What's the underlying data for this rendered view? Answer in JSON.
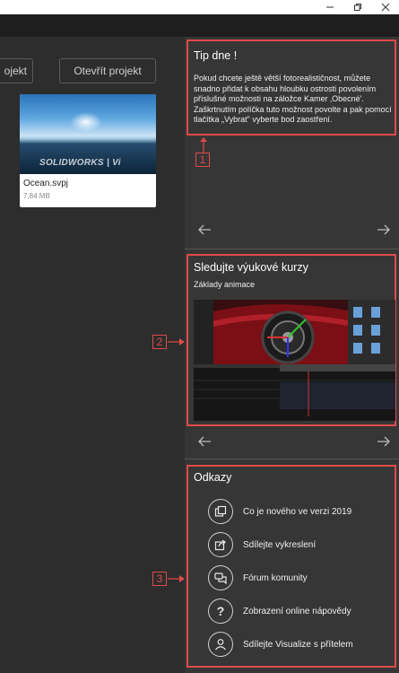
{
  "window": {
    "minimize_icon": "minimize-icon",
    "restore_icon": "restore-icon",
    "close_icon": "close-icon"
  },
  "left": {
    "new_project_button_partial": "ojekt",
    "open_project_button": "Otevřít projekt",
    "recent_file": {
      "name": "Ocean.svpj",
      "size": "7,84 MB",
      "thumbnail_watermark": "SOLIDWORKS | Vi"
    }
  },
  "tip": {
    "title": "Tip dne !",
    "text": "Pokud chcete ještě větší fotorealističnost, můžete snadno přidat k obsahu hloubku ostrosti povolením příslušné možnosti na záložce Kamer ‚Obecné'. Zaškrtnutím políčka tuto možnost povolte a pak pomocí tlačítka „Vybrat\" vyberte bod zaostření.",
    "callout": "1"
  },
  "tutorials": {
    "title": "Sledujte výukové kurzy",
    "subtitle": "Základy animace",
    "callout": "2"
  },
  "links": {
    "title": "Odkazy",
    "callout": "3",
    "items": [
      {
        "label": "Co je nového ve verzi 2019",
        "icon": "copy-icon"
      },
      {
        "label": "Sdílejte vykreslení",
        "icon": "share-icon"
      },
      {
        "label": "Fórum komunity",
        "icon": "chat-bubbles-icon"
      },
      {
        "label": "Zobrazení online nápovědy",
        "icon": "question-icon"
      },
      {
        "label": "Sdílejte Visualize s přítelem",
        "icon": "user-icon"
      }
    ]
  },
  "colors": {
    "highlight": "#e04a4a",
    "panel_bg": "#363636",
    "left_bg": "#2d2d2d"
  }
}
